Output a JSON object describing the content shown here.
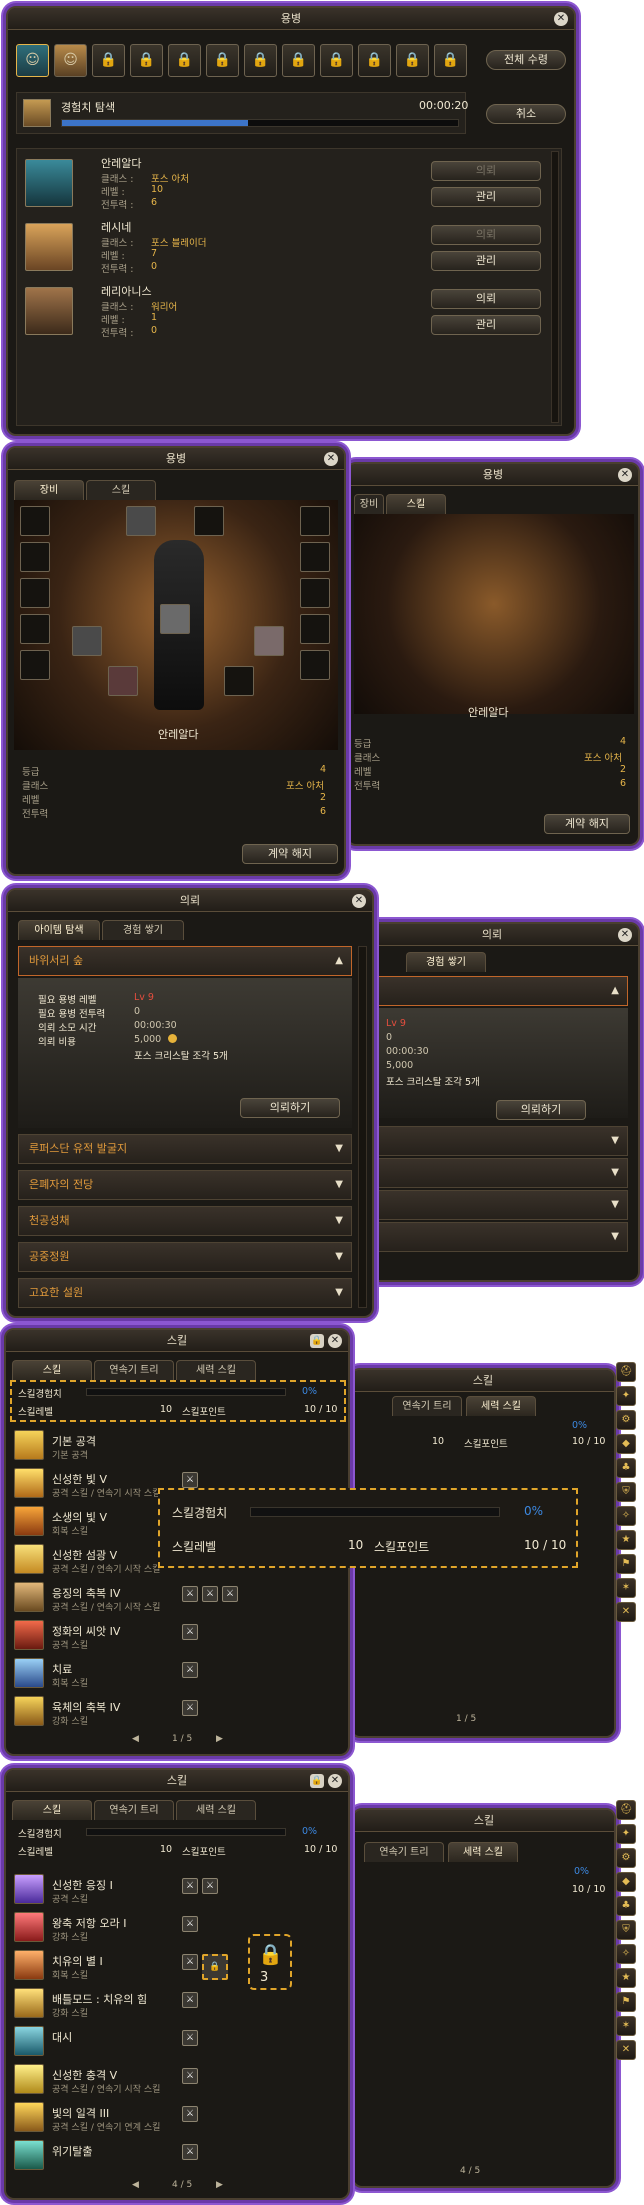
{
  "merc": {
    "title": "용병",
    "trainAll": "전체 수령",
    "cancel": "취소",
    "task": "경험치 탐색",
    "timer": "00:00:20",
    "commission": "의뢰",
    "manage": "관리",
    "labels": {
      "class": "클래스 :",
      "level": "레벨 :",
      "power": "전투력 :"
    },
    "list": [
      {
        "name": "안레알다",
        "class": "포스 아처",
        "level": "10",
        "power": "6"
      },
      {
        "name": "레시네",
        "class": "포스 블레이더",
        "level": "7",
        "power": "0"
      },
      {
        "name": "레리아니스",
        "class": "워리어",
        "level": "1",
        "power": "0"
      }
    ]
  },
  "equip": {
    "title": "용병",
    "tabEquip": "장비",
    "tabSkill": "스킬",
    "charName": "안레알다",
    "grade": "등급",
    "gradeVal": "4",
    "cls": "클래스",
    "clsVal": "포스 아처",
    "lv": "레벨",
    "lvVal": "2",
    "pw": "전투력",
    "pwVal": "6",
    "release": "계약 해지"
  },
  "request": {
    "title": "의뢰",
    "tab1": "아이템 탐색",
    "tab2": "경험 쌓기",
    "open": "바위서리 숲",
    "rows": [
      {
        "k": "필요 용병 레벨",
        "v": "Lv 9"
      },
      {
        "k": "필요 용병 전투력",
        "v": "0"
      },
      {
        "k": "의뢰 소모 시간",
        "v": "00:00:30"
      },
      {
        "k": "의뢰 비용",
        "v": "5,000"
      }
    ],
    "reward": "포스 크리스탈 조각 5개",
    "doBtn": "의뢰하기",
    "others": [
      "루퍼스단 유적 발굴지",
      "은폐자의 전당",
      "천공성채",
      "공중정원",
      "고요한 설원"
    ]
  },
  "skill1": {
    "title": "스킬",
    "tab1": "스킬",
    "tab2": "연속기 트리",
    "tab3": "세력 스킬",
    "expLabel": "스킬경험치",
    "exp": "0%",
    "lvLabel": "스킬레벨",
    "lv": "10",
    "spLabel": "스킬포인트",
    "sp": "10 / 10",
    "page": "1 / 5",
    "skills": [
      {
        "n": "기본 공격",
        "t": "기본 공격"
      },
      {
        "n": "신성한 빛 V",
        "t": "공격 스킬 / 연속기 시작 스킬"
      },
      {
        "n": "소생의 빛 V",
        "t": "회복 스킬"
      },
      {
        "n": "신성한 섬광 V",
        "t": "공격 스킬 / 연속기 시작 스킬"
      },
      {
        "n": "응징의 축복 IV",
        "t": "공격 스킬 / 연속기 시작 스킬"
      },
      {
        "n": "정화의 씨앗 IV",
        "t": "공격 스킬"
      },
      {
        "n": "치료",
        "t": "회복 스킬"
      },
      {
        "n": "육체의 축복 IV",
        "t": "강화 스킬"
      }
    ]
  },
  "skill2": {
    "title": "스킬",
    "page": "4 / 5",
    "lockNum": "3",
    "skills": [
      {
        "n": "신성한 응징 I",
        "t": "공격 스킬"
      },
      {
        "n": "왕축 저항 오라 I",
        "t": "강화 스킬"
      },
      {
        "n": "치유의 별 I",
        "t": "회복 스킬"
      },
      {
        "n": "배틀모드 : 치유의 힘",
        "t": "강화 스킬"
      },
      {
        "n": "대시",
        "t": ""
      },
      {
        "n": "신성한 충격 V",
        "t": "공격 스킬 / 연속기 시작 스킬"
      },
      {
        "n": "빛의 일격 III",
        "t": "공격 스킬 / 연속기 연계 스킬"
      },
      {
        "n": "위기탈출",
        "t": ""
      }
    ]
  }
}
